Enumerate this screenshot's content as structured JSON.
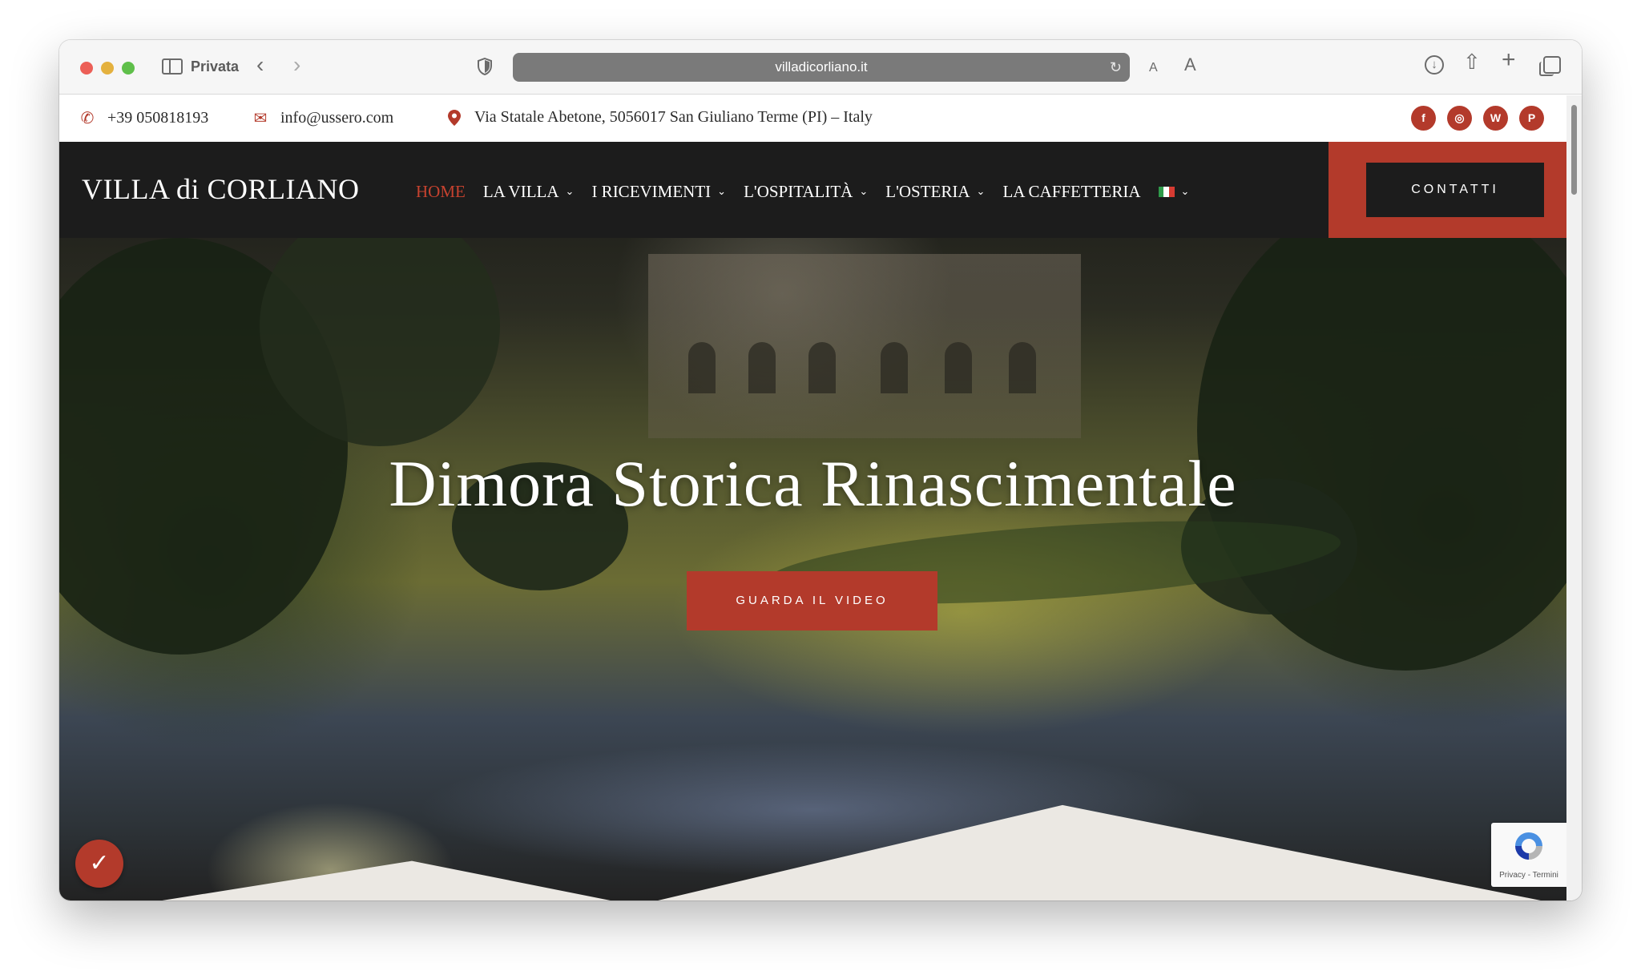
{
  "browser": {
    "private_label": "Privata",
    "url": "villadicorliano.it",
    "text_small": "A",
    "text_large": "A"
  },
  "topbar": {
    "phone": "+39 050818193",
    "email": "info@ussero.com",
    "address": "Via Statale Abetone, 5056017 San Giuliano Terme (PI) – Italy",
    "social": [
      "facebook-icon",
      "instagram-icon",
      "w-icon",
      "pinterest-icon"
    ],
    "social_glyphs": {
      "facebook": "f",
      "instagram": "◎",
      "w": "W",
      "pinterest": "P"
    }
  },
  "nav": {
    "logo": "VILLA di CORLIANO",
    "items": [
      {
        "label": "HOME",
        "active": true,
        "dropdown": false
      },
      {
        "label": "LA VILLA",
        "active": false,
        "dropdown": true
      },
      {
        "label": "I RICEVIMENTI",
        "active": false,
        "dropdown": true
      },
      {
        "label": "L'OSPITALITÀ",
        "active": false,
        "dropdown": true
      },
      {
        "label": "L'OSTERIA",
        "active": false,
        "dropdown": true
      },
      {
        "label": "LA CAFFETTERIA",
        "active": false,
        "dropdown": false
      }
    ],
    "contact_label": "CONTATTI"
  },
  "hero": {
    "title": "Dimora Storica Rinascimentale",
    "cta_label": "GUARDA IL VIDEO"
  },
  "recaptcha": {
    "text": "Privacy - Termini"
  },
  "colors": {
    "accent": "#b33a2b",
    "nav_bg": "#1c1c1c",
    "wave": "#ebe8e3"
  }
}
